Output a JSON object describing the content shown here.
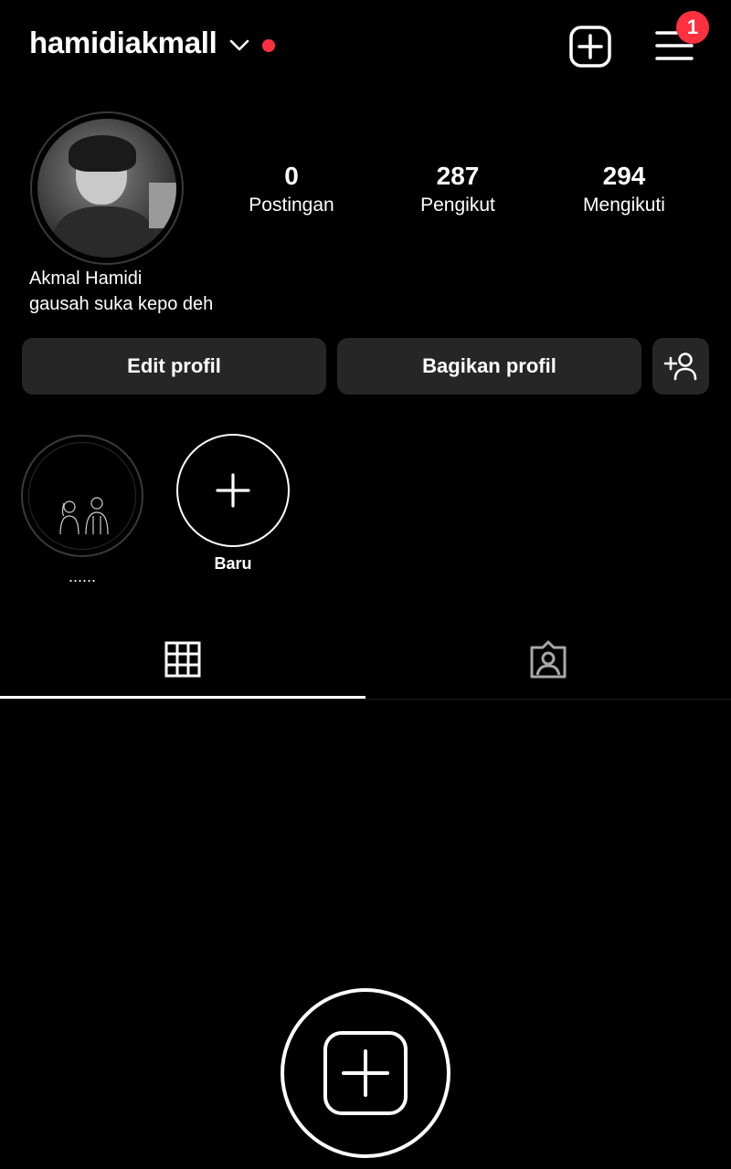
{
  "header": {
    "username": "hamidiakmall",
    "notification_count": "1",
    "accent_color": "#ff3040"
  },
  "profile": {
    "stats": [
      {
        "value": "0",
        "label": "Postingan"
      },
      {
        "value": "287",
        "label": "Pengikut"
      },
      {
        "value": "294",
        "label": "Mengikuti"
      }
    ],
    "full_name": "Akmal Hamidi",
    "bio": "gausah suka kepo deh"
  },
  "actions": {
    "edit_label": "Edit profil",
    "share_label": "Bagikan profil"
  },
  "highlights": {
    "items": [
      {
        "label": "......"
      }
    ],
    "new_label": "Baru"
  },
  "tabs": [
    {
      "icon": "grid-icon",
      "active": true
    },
    {
      "icon": "tagged-icon",
      "active": false
    }
  ],
  "icons": {
    "header": [
      "chevron-down-icon",
      "new-post-icon",
      "hamburger-menu-icon"
    ],
    "actions": [
      "add-person-icon"
    ],
    "empty_state": "plus-square-icon"
  }
}
